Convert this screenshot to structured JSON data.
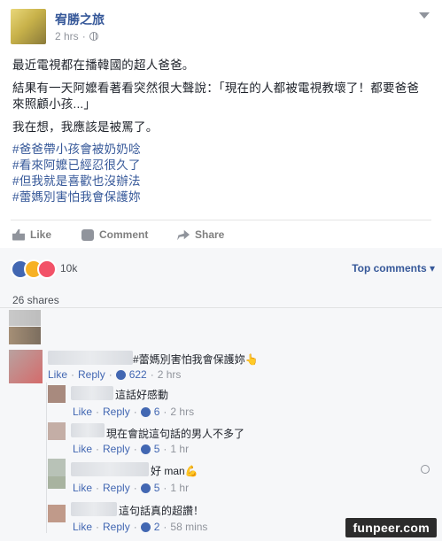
{
  "post": {
    "author": "宥勝之旅",
    "time": "2 hrs",
    "separator": "·",
    "lines": [
      "最近電視都在播韓國的超人爸爸。",
      "結果有一天阿嬤看著看突然很大聲說：「現在的人都被電視教壞了！都要爸爸",
      "來照顧小孩...」",
      "我在想，我應該是被罵了。"
    ],
    "hashtags": [
      "#爸爸帶小孩會被奶奶唸",
      "#看來阿嬤已經忍很久了",
      "#但我就是喜歡也沒辦法",
      "#蕾媽別害怕我會保護妳"
    ]
  },
  "actions": {
    "like": "Like",
    "comment": "Comment",
    "share": "Share"
  },
  "reactions": {
    "count": "10k",
    "top_comments": "Top comments ▾"
  },
  "shares": "26 shares",
  "comments": [
    {
      "text": "#蕾媽別害怕我會保護妳👆",
      "like": "Like",
      "reply": "Reply",
      "likes": "622",
      "time": "2 hrs"
    },
    {
      "text": "這話好感動",
      "like": "Like",
      "reply": "Reply",
      "likes": "6",
      "time": "2 hrs"
    },
    {
      "text": "現在會說這句話的男人不多了",
      "like": "Like",
      "reply": "Reply",
      "likes": "5",
      "time": "1 hr"
    },
    {
      "text": "好 man💪",
      "like": "Like",
      "reply": "Reply",
      "likes": "5",
      "time": "1 hr"
    },
    {
      "text": "這句話真的超讚！",
      "like": "Like",
      "reply": "Reply",
      "likes": "2",
      "time": "58 mins"
    }
  ],
  "meta_sep": "·",
  "watermark": "funpeer.com"
}
